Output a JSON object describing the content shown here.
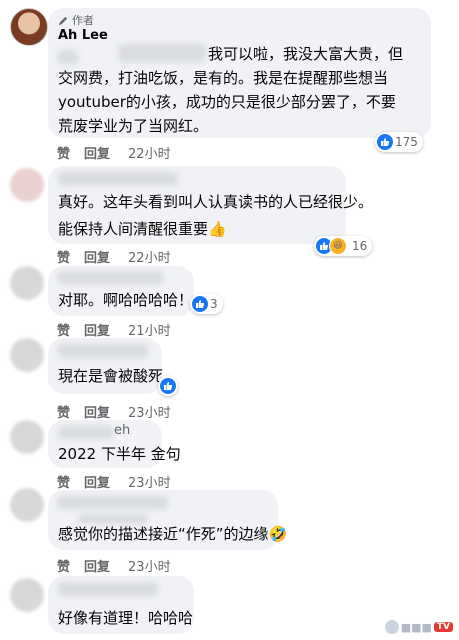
{
  "comments": [
    {
      "author_badge": "作者",
      "name": "Ah Lee",
      "lines": [
        "我可以啦，我没大富大贵，但",
        "交网费，打油吃饭，是有的。我是在提醒那些想当",
        "youtuber的小孩，成功的只是很少部分罢了，不要",
        "荒废学业为了当网红。"
      ],
      "reactions": "175",
      "time": "22小时"
    },
    {
      "lines": [
        "真好。这年头看到叫人认真读书的人已经很少。",
        "能保持人间清醒很重要👍"
      ],
      "reactions": "16",
      "time": "22小时"
    },
    {
      "lines": [
        "对耶。啊哈哈哈哈！"
      ],
      "reactions": "3",
      "time": "21小时"
    },
    {
      "lines": [
        "現在是會被酸死"
      ],
      "time": "23小时"
    },
    {
      "name_fragment": "eh",
      "lines": [
        "2022 下半年 金句"
      ],
      "time": "23小时"
    },
    {
      "lines": [
        "感觉你的描述接近“作死”的边缘🤣"
      ],
      "time": "23小时"
    },
    {
      "lines": [
        "好像有道理！哈哈哈"
      ],
      "time": "23小时"
    }
  ],
  "actions": {
    "like": "赞",
    "reply": "回复"
  },
  "watermark": {
    "text": "TV"
  },
  "colors": {
    "bubble": "#f0f2f5",
    "like_blue": "#1877f2",
    "meta_gray": "#65676b"
  }
}
